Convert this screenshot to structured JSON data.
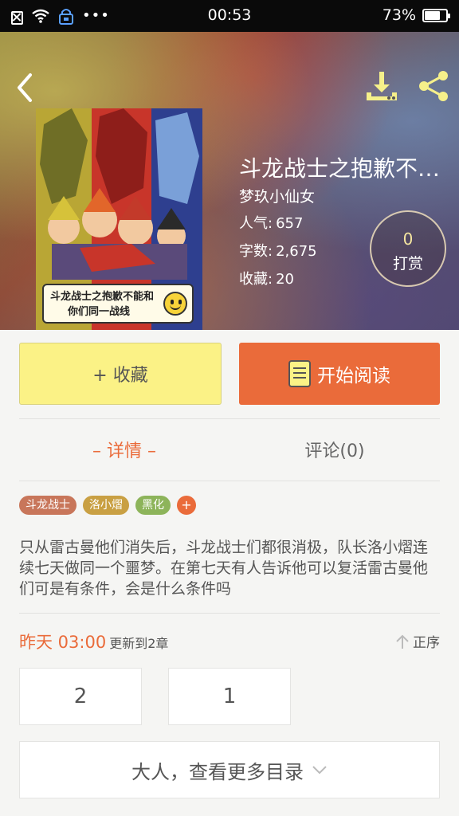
{
  "status_bar": {
    "time": "00:53",
    "battery": "73%",
    "battery_level": 0.73,
    "dots": "•••",
    "icons": [
      "sim-icon",
      "wifi-icon",
      "vpn-icon",
      "more-dots-icon",
      "battery-icon"
    ]
  },
  "header": {
    "back_icon": "back-arrow-icon",
    "download_icon": "download-icon",
    "share_icon": "share-icon",
    "cover": {
      "caption_line1": "斗龙战士之抱歉不能和",
      "caption_line2": "你们同一战线"
    },
    "title": "斗龙战士之抱歉不能和你们同一战线",
    "author": "梦玖小仙女",
    "stats": [
      {
        "label": "人气:",
        "value": "657"
      },
      {
        "label": "字数:",
        "value": "2,675"
      },
      {
        "label": "收藏:",
        "value": "20"
      }
    ],
    "reward": {
      "count": "0",
      "label": "打赏"
    }
  },
  "actions": {
    "collect_label": "+ 收藏",
    "read_label": "开始阅读",
    "read_icon": "book-icon"
  },
  "tabs": {
    "detail": "– 详情 –",
    "comment": "评论(0)"
  },
  "tags": [
    {
      "label": "斗龙战士",
      "color": "#c8765a"
    },
    {
      "label": "洛小熠",
      "color": "#c9a043"
    },
    {
      "label": "黑化",
      "color": "#8db45a"
    },
    {
      "label": "+",
      "color": "#ea6b3a"
    }
  ],
  "description": "只从雷古曼他们消失后，斗龙战士们都很消极，队长洛小熠连续七天做同一个噩梦。在第七天有人告诉他可以复活雷古曼他们可是有条件，会是什么条件吗",
  "update": {
    "time": "昨天 03:00",
    "text": "更新到2章",
    "sort_label": "正序",
    "sort_icon": "sort-up-arrow-icon"
  },
  "chapters": [
    "2",
    "1"
  ],
  "more": {
    "label": "大人，查看更多目录",
    "icon": "chevron-down-icon"
  },
  "colors": {
    "accent": "#ea6b3a",
    "collect_bg": "#fbf286",
    "page_bg": "#f5f5f3"
  }
}
